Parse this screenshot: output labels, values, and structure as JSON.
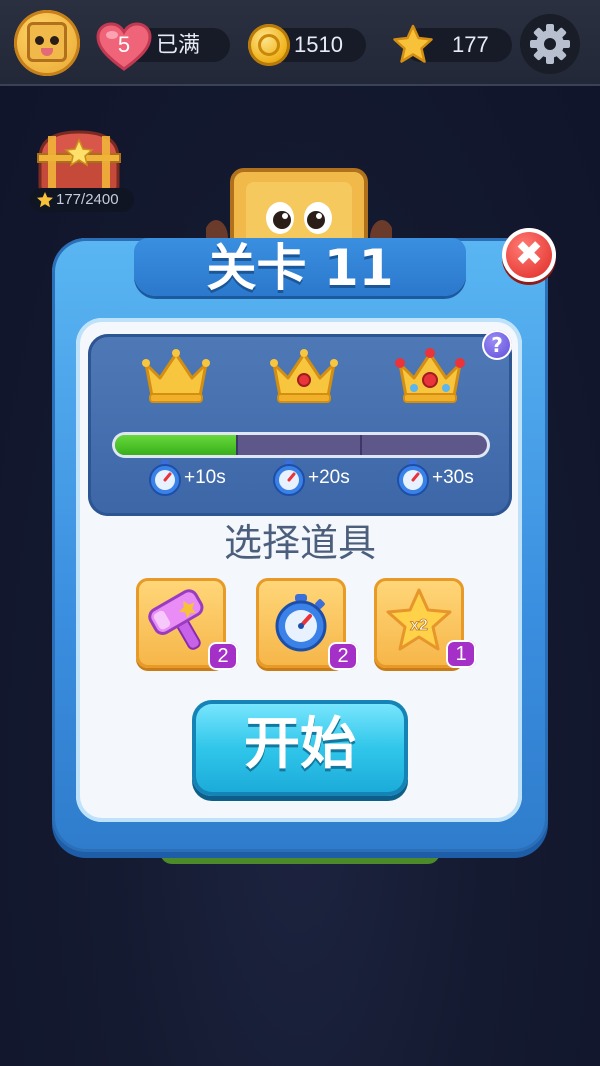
{
  "topbar": {
    "lives": "5",
    "lives_status": "已满",
    "coins": "1510",
    "stars": "177"
  },
  "chest": {
    "progress_text": "177/2400"
  },
  "dialog": {
    "title": "关卡 11",
    "close_symbol": "✖",
    "help_symbol": "?",
    "crowns": [
      "crown-bronze-icon",
      "crown-silver-icon",
      "crown-gold-icon"
    ],
    "progress_fraction": 0.33,
    "time_bonuses": [
      "+10s",
      "+20s",
      "+30s"
    ],
    "boosters_title": "选择道具",
    "boosters": [
      {
        "name": "hammer",
        "count": "2"
      },
      {
        "name": "stopwatch",
        "count": "2"
      },
      {
        "name": "double-star",
        "count": "1",
        "label": "x2"
      }
    ],
    "start_label": "开始"
  },
  "colors": {
    "dialog_blue": "#3b8fe0",
    "progress_green": "#38b01a",
    "start_cyan": "#30c6ea",
    "close_red": "#e8403a",
    "badge_purple": "#a530c8"
  }
}
